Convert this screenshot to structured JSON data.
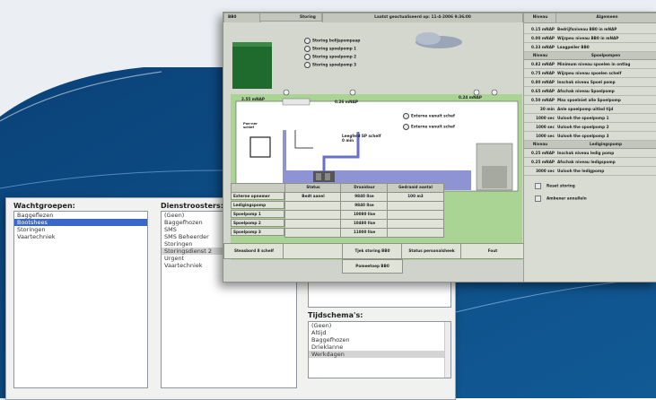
{
  "back_window": {
    "wachtgroepen": {
      "title": "Wachtgroepen:",
      "items": [
        "Baggeflezen",
        "Bootshees",
        "Storingen",
        "Vaartechniek"
      ],
      "selected_index": 1
    },
    "dienstroosters": {
      "title": "Dienstroosters:",
      "items": [
        "(Geen)",
        "Baggefhozen",
        "SMS",
        "SMS Beheerder",
        "Storingen",
        "Storingsdienst 2",
        "Urgent",
        "Vaartechniek"
      ],
      "selected_index": 5
    },
    "tijdschemas": {
      "title": "Tijdschema's:",
      "items": [
        "(Geen)",
        "Altijd",
        "Baggefhozen",
        "Drieklanne",
        "Werkdagen"
      ],
      "selected_index": 4
    }
  },
  "front_window": {
    "header": {
      "c1": "BB0",
      "c2": "Storing",
      "c3": "Laatst geactualiseerd op: 11-4-2006 9:36:00",
      "c4": "Niveau",
      "c5": "Algemeen"
    },
    "radio_items": [
      "Storing bolljspompaap",
      "Storing spoelpomp 1",
      "Storing spoelpomp 2",
      "Storing spoelpomp 3"
    ],
    "diagram": {
      "level_left": "2.55 mNAP",
      "level_mid": "0.26 mNAP",
      "level_right": "0.24 mNAP",
      "box_label": "Pon-ner schlef",
      "extern_1": "Externe vanuit schef",
      "extern_2": "Externe vanuit schef",
      "legend": "Leegfeld SP schelf\n0 min"
    },
    "table": {
      "headers": [
        "",
        "Status",
        "Draaidaur",
        "Gedraaid aantal"
      ],
      "rows": [
        [
          "Externe opnemer",
          "Bedt aanel",
          "9840 Ilse",
          "100 m3"
        ],
        [
          "Ledigingspomp",
          "",
          "9840 Ilse",
          ""
        ],
        [
          "Spoelpomp 1",
          "",
          "10080 Ilse",
          ""
        ],
        [
          "Spoelpomp 2",
          "",
          "10480 Ilse",
          ""
        ],
        [
          "Spoelpomp 3",
          "",
          "11000 Ilse",
          ""
        ]
      ]
    },
    "footer": {
      "c1": "Steasbord 8 schelf",
      "c2": "Tjek storing BB0",
      "c3": "Status personalsheek",
      "c4": "Fout",
      "c5": "Pomeetoep BB0"
    },
    "right_panel": {
      "sec1": {
        "head": "Niveau",
        "title": "Algemeen",
        "rows": [
          {
            "v": "0.15 mNAP",
            "t": "Bedrijfsniveau BB0 in mNAP"
          },
          {
            "v": "0.00 mNAP",
            "t": "Wijzpeu niveau BB0 in mNAP"
          },
          {
            "v": "0.33 mNAP",
            "t": "Laagpeiler BB0"
          }
        ]
      },
      "sec2": {
        "head": "Niveau",
        "title": "Spoelpompen",
        "rows": [
          {
            "v": "0.82 mNAP",
            "t": "Minimum niveau spoelen in ontlag"
          },
          {
            "v": "0.75 mNAP",
            "t": "Wijzpeu niveau spoelen schelf"
          },
          {
            "v": "0.80 mNAP",
            "t": "Inschak niveau Spoel pomp"
          },
          {
            "v": "0.65 mNAP",
            "t": "Afschak niveau Spoelpomp"
          },
          {
            "v": "0.50 mNAP",
            "t": "Max spoelniet alle Spoelpomp"
          },
          {
            "v": "30 min",
            "t": "Anle spoelpomp uitlad tijd"
          },
          {
            "v": "1000 sec",
            "t": "Uulooh the spoelpomp 1"
          },
          {
            "v": "1000 sec",
            "t": "Uulooh the spoelpomp 2"
          },
          {
            "v": "1000 sec",
            "t": "Uulooh the spoelpomp 3"
          }
        ]
      },
      "sec3": {
        "head": "Niveau",
        "title": "Ledigingspomp",
        "rows": [
          {
            "v": "0.25 mNAP",
            "t": "Inschak niveau ledig pomp"
          },
          {
            "v": "0.25 mNAP",
            "t": "Afschak niveau ledigspomp"
          },
          {
            "v": "3000 sec",
            "t": "Uulooh the ledigpomp"
          }
        ]
      },
      "checks": [
        "Reset storing",
        "Ambener annulleln"
      ]
    }
  },
  "colors": {
    "bg_dark": "#0e4f86",
    "bg_light": "#e8edf3",
    "water": "#8e93d4",
    "green_field": "#a9d494",
    "tank_green": "#1f6b2e",
    "selection": "#3b68c8"
  }
}
